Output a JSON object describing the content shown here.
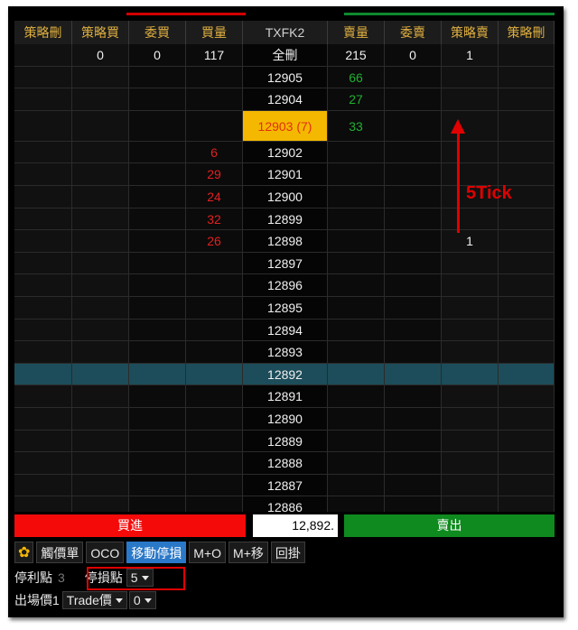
{
  "header": {
    "columns": [
      "策略刪",
      "策略買",
      "委買",
      "買量",
      "TXFK2",
      "賣量",
      "委賣",
      "策略賣",
      "策略刪"
    ]
  },
  "rows": [
    {
      "c": [
        "",
        "0",
        "0",
        "117",
        "全刪",
        "215",
        "0",
        "1",
        ""
      ],
      "color": [
        "",
        "",
        "",
        "",
        "",
        "",
        "",
        "",
        ""
      ]
    },
    {
      "c": [
        "",
        "",
        "",
        "",
        "12905",
        "66",
        "",
        "",
        ""
      ],
      "color": [
        "",
        "",
        "",
        "",
        "",
        "green",
        "",
        "",
        ""
      ]
    },
    {
      "c": [
        "",
        "",
        "",
        "",
        "12904",
        "27",
        "",
        "",
        ""
      ],
      "color": [
        "",
        "",
        "",
        "",
        "",
        "green",
        "",
        "",
        ""
      ]
    },
    {
      "c": [
        "",
        "",
        "",
        "",
        "12903 (7)",
        "33",
        "",
        "",
        ""
      ],
      "color": [
        "",
        "",
        "",
        "",
        "",
        "green",
        "",
        "",
        ""
      ],
      "current": true
    },
    {
      "c": [
        "",
        "",
        "",
        "6",
        "12902",
        "",
        "",
        "",
        ""
      ],
      "color": [
        "",
        "",
        "",
        "red",
        "",
        "",
        "",
        "",
        ""
      ]
    },
    {
      "c": [
        "",
        "",
        "",
        "29",
        "12901",
        "",
        "",
        "",
        ""
      ],
      "color": [
        "",
        "",
        "",
        "red",
        "",
        "",
        "",
        "",
        ""
      ]
    },
    {
      "c": [
        "",
        "",
        "",
        "24",
        "12900",
        "",
        "",
        "",
        ""
      ],
      "color": [
        "",
        "",
        "",
        "red",
        "",
        "",
        "",
        "",
        ""
      ]
    },
    {
      "c": [
        "",
        "",
        "",
        "32",
        "12899",
        "",
        "",
        "",
        ""
      ],
      "color": [
        "",
        "",
        "",
        "red",
        "",
        "",
        "",
        "",
        ""
      ]
    },
    {
      "c": [
        "",
        "",
        "",
        "26",
        "12898",
        "",
        "",
        "1",
        ""
      ],
      "color": [
        "",
        "",
        "",
        "red",
        "",
        "",
        "",
        "",
        ""
      ]
    },
    {
      "c": [
        "",
        "",
        "",
        "",
        "12897",
        "",
        "",
        "",
        ""
      ]
    },
    {
      "c": [
        "",
        "",
        "",
        "",
        "12896",
        "",
        "",
        "",
        ""
      ]
    },
    {
      "c": [
        "",
        "",
        "",
        "",
        "12895",
        "",
        "",
        "",
        ""
      ]
    },
    {
      "c": [
        "",
        "",
        "",
        "",
        "12894",
        "",
        "",
        "",
        ""
      ]
    },
    {
      "c": [
        "",
        "",
        "",
        "",
        "12893",
        "",
        "",
        "",
        ""
      ]
    },
    {
      "c": [
        "",
        "",
        "",
        "",
        "12892",
        "",
        "",
        "",
        ""
      ],
      "selected": true
    },
    {
      "c": [
        "",
        "",
        "",
        "",
        "12891",
        "",
        "",
        "",
        ""
      ]
    },
    {
      "c": [
        "",
        "",
        "",
        "",
        "12890",
        "",
        "",
        "",
        ""
      ]
    },
    {
      "c": [
        "",
        "",
        "",
        "",
        "12889",
        "",
        "",
        "",
        ""
      ]
    },
    {
      "c": [
        "",
        "",
        "",
        "",
        "12888",
        "",
        "",
        "",
        ""
      ]
    },
    {
      "c": [
        "",
        "",
        "",
        "",
        "12887",
        "",
        "",
        "",
        ""
      ]
    },
    {
      "c": [
        "",
        "",
        "",
        "",
        "12886",
        "",
        "",
        "",
        ""
      ]
    }
  ],
  "annotation": {
    "label": "5Tick",
    "color": "#e00000"
  },
  "order_bar": {
    "buy_label": "買進",
    "price_value": "12,892.",
    "sell_label": "賣出"
  },
  "toolbar": {
    "items": [
      {
        "label": "觸價單",
        "active": false
      },
      {
        "label": "OCO",
        "active": false
      },
      {
        "label": "移動停損",
        "active": true
      },
      {
        "label": "M+O",
        "active": false
      },
      {
        "label": "M+移",
        "active": false
      },
      {
        "label": "回掛",
        "active": false
      }
    ]
  },
  "settings": {
    "take_profit_label": "停利點",
    "take_profit_value": "3",
    "stop_loss_label": "停損點",
    "stop_loss_value": "5",
    "exit_label": "出場價1",
    "exit_type": "Trade價",
    "exit_offset": "0"
  },
  "colors": {
    "buy": "#f50a0a",
    "sell": "#0e8a1e",
    "header_text": "#e0b040",
    "current_price_bg": "#f5b800"
  }
}
